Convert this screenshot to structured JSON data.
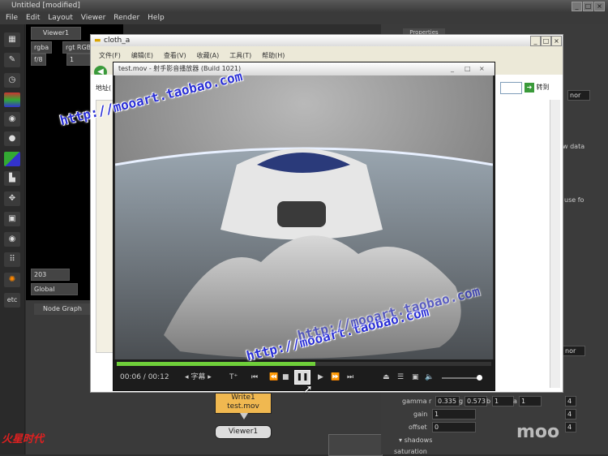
{
  "nuke": {
    "title": "Untitled [modified]",
    "menu": [
      "File",
      "Edit",
      "Layout",
      "Viewer",
      "Render",
      "Help"
    ],
    "viewer_tab": "Viewer1",
    "viewer_controls": {
      "channels": "rgba",
      "rgb": "rgt RGB",
      "fstop": "f/8",
      "frame_field": "1",
      "frame": "203",
      "global": "Global"
    },
    "node_graph_tab": "Node Graph",
    "properties_tab": "Properties",
    "props": {
      "none1": "nor",
      "none2": "nor",
      "data_label": "w data",
      "use_label": "use fo",
      "gamma_label": "gamma",
      "gamma_r": "0.335",
      "gamma_g": "0.573",
      "gamma_b": "1",
      "gamma_a": "1",
      "gain_label": "gain",
      "gain_value": "1",
      "offset_label": "offset",
      "offset_value": "0",
      "shadows_label": "shadows",
      "saturation_label": "saturation",
      "num4": "4",
      "r": "r",
      "g": "g",
      "b": "b",
      "a": "a"
    },
    "nodes": {
      "write_label": "Write1",
      "write_file": "test.mov",
      "viewer_node": "Viewer1"
    }
  },
  "explorer": {
    "title": "cloth_a",
    "menu": [
      "文件(F)",
      "编辑(E)",
      "查看(V)",
      "收藏(A)",
      "工具(T)",
      "帮助(H)"
    ],
    "address_label": "地址(",
    "go_label": "转到"
  },
  "player": {
    "title": "test.mov - 射手影音播放器 (Build 1021)",
    "time": "00:06 / 00:12",
    "subtitle_btn": "字幕",
    "progress": 0.53,
    "volume": 0.85
  },
  "watermarks": [
    "http://mooart.taobao.com",
    "http://mooart.taobao.com",
    "http://mooart.taobao.com"
  ],
  "logos": {
    "bottom_left": "火星时代",
    "bottom_right": "moo"
  }
}
